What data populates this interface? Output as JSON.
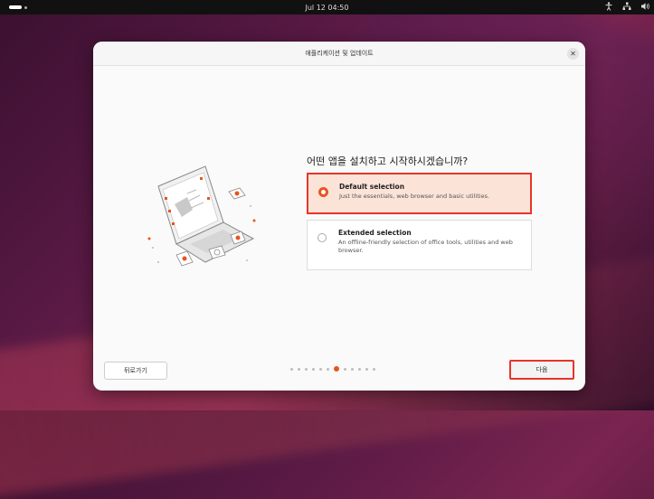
{
  "topbar": {
    "clock": "Jul 12  04:50",
    "icons": [
      "accessibility-icon",
      "network-icon",
      "volume-icon"
    ]
  },
  "dialog": {
    "title": "애플리케이션 및 업데이트",
    "question": "어떤 앱을 설치하고 시작하시겠습니까?",
    "options": [
      {
        "title": "Default selection",
        "description": "Just the essentials, web browser and basic utilities.",
        "selected": true
      },
      {
        "title": "Extended selection",
        "description": "An offline-friendly selection of office tools, utilities and web browser.",
        "selected": false
      }
    ],
    "back_label": "뒤로가기",
    "next_label": "다음",
    "pager": {
      "total": 12,
      "current": 7
    }
  },
  "colors": {
    "accent": "#e95420",
    "highlight_border": "#e8342a",
    "selected_bg": "#fbe3d8"
  }
}
